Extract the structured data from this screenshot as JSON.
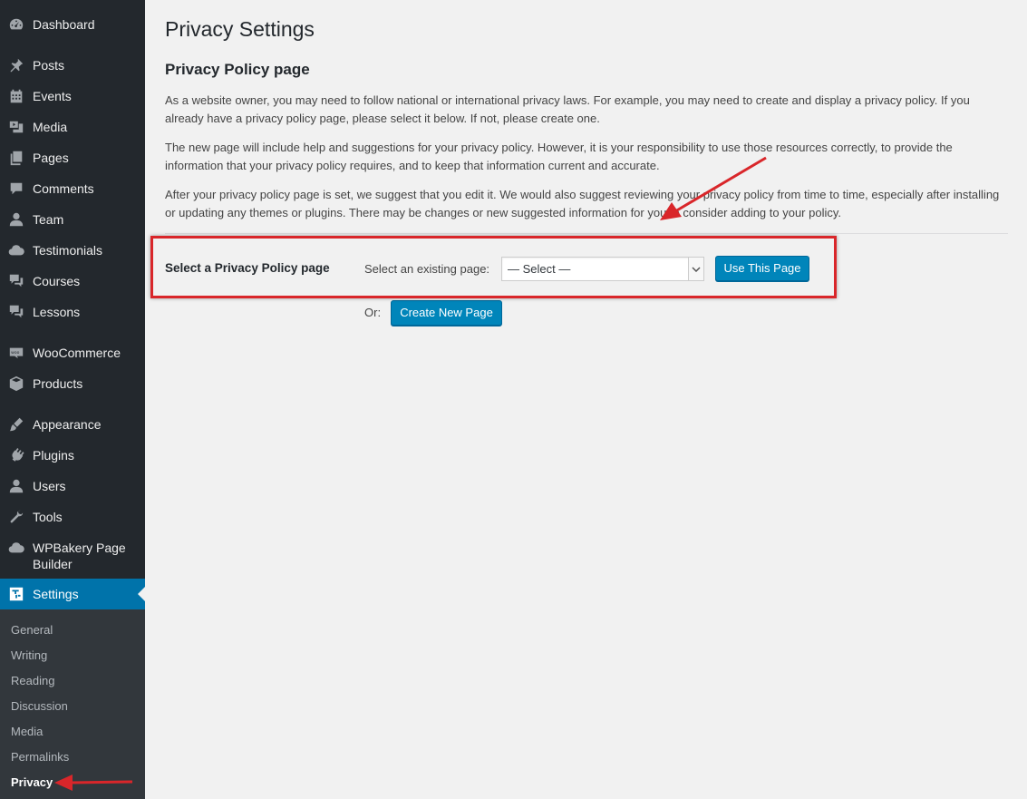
{
  "sidebar": {
    "items": [
      {
        "label": "Dashboard",
        "icon": "dashboard-icon"
      },
      {
        "label": "Posts",
        "icon": "pin-icon"
      },
      {
        "label": "Events",
        "icon": "calendar-icon"
      },
      {
        "label": "Media",
        "icon": "media-icon"
      },
      {
        "label": "Pages",
        "icon": "pages-icon"
      },
      {
        "label": "Comments",
        "icon": "comment-icon"
      },
      {
        "label": "Team",
        "icon": "user-icon"
      },
      {
        "label": "Testimonials",
        "icon": "cloud-icon"
      },
      {
        "label": "Courses",
        "icon": "comments-icon"
      },
      {
        "label": "Lessons",
        "icon": "comments-icon"
      },
      {
        "label": "WooCommerce",
        "icon": "woo-icon"
      },
      {
        "label": "Products",
        "icon": "box-icon"
      },
      {
        "label": "Appearance",
        "icon": "brush-icon"
      },
      {
        "label": "Plugins",
        "icon": "plugin-icon"
      },
      {
        "label": "Users",
        "icon": "user-icon"
      },
      {
        "label": "Tools",
        "icon": "wrench-icon"
      },
      {
        "label": "WPBakery Page Builder",
        "icon": "cloud-icon"
      },
      {
        "label": "Settings",
        "icon": "settings-icon"
      }
    ],
    "submenu": [
      "General",
      "Writing",
      "Reading",
      "Discussion",
      "Media",
      "Permalinks",
      "Privacy"
    ],
    "current_submenu": "Privacy"
  },
  "main": {
    "page_title": "Privacy Settings",
    "section_title": "Privacy Policy page",
    "paragraphs": [
      "As a website owner, you may need to follow national or international privacy laws. For example, you may need to create and display a privacy policy. If you already have a privacy policy page, please select it below. If not, please create one.",
      "The new page will include help and suggestions for your privacy policy. However, it is your responsibility to use those resources correctly, to provide the information that your privacy policy requires, and to keep that information current and accurate.",
      "After your privacy policy page is set, we suggest that you edit it. We would also suggest reviewing your privacy policy from time to time, especially after installing or updating any themes or plugins. There may be changes or new suggested information for you to consider adding to your policy."
    ],
    "form": {
      "label": "Select a Privacy Policy page",
      "select_label": "Select an existing page:",
      "select_value": "— Select —",
      "use_button": "Use This Page",
      "or_label": "Or:",
      "create_button": "Create New Page"
    }
  },
  "colors": {
    "sidebar_bg": "#23282d",
    "submenu_bg": "#32373c",
    "active_bg": "#0073aa",
    "button_bg": "#0085ba",
    "annotation_red": "#d9262a"
  }
}
